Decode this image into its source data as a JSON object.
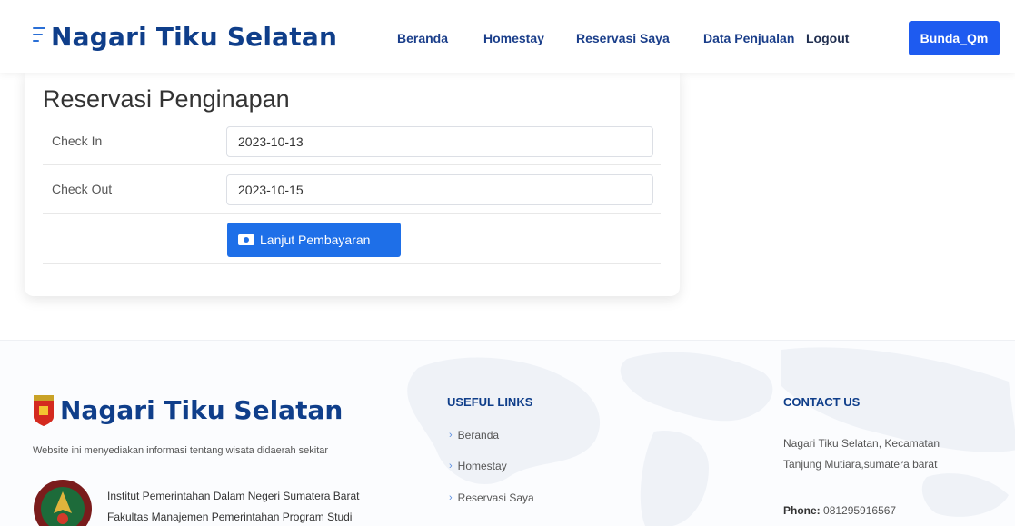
{
  "header": {
    "brand": "Nagari Tiku Selatan",
    "nav": {
      "beranda": "Beranda",
      "homestay": "Homestay",
      "reservasi": "Reservasi Saya",
      "data_penjualan": "Data Penjualan",
      "logout": "Logout"
    },
    "user": "Bunda_Qm"
  },
  "reservation": {
    "title": "Reservasi Penginapan",
    "check_in_label": "Check In",
    "check_in_value": "2023-10-13",
    "check_out_label": "Check Out",
    "check_out_value": "2023-10-15",
    "submit_label": "Lanjut Pembayaran"
  },
  "footer": {
    "brand": "Nagari Tiku Selatan",
    "description": "Website ini menyediakan informasi tentang wisata didaerah sekitar",
    "institution_line1": "Institut Pemerintahan Dalam Negeri Sumatera Barat",
    "institution_line2": "Fakultas Manajemen Pemerintahan Program Studi",
    "useful_links_title": "USEFUL LINKS",
    "links": [
      "Beranda",
      "Homestay",
      "Reservasi Saya"
    ],
    "contact_title": "CONTACT US",
    "address_line1": "Nagari Tiku Selatan, Kecamatan",
    "address_line2": "Tanjung Mutiara,sumatera barat",
    "phone_label": "Phone:",
    "phone_value": "081295916567"
  },
  "colors": {
    "brand_blue": "#0f3e8a",
    "primary_button": "#1e5bf0"
  }
}
